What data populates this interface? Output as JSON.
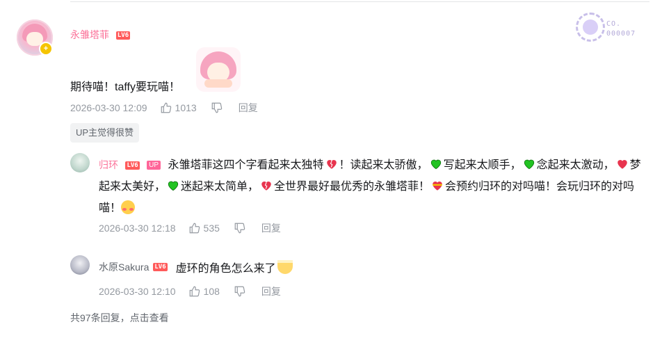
{
  "comment": {
    "username": "永雏塔菲",
    "level": "LV6",
    "text": "期待喵！taffy要玩喵！",
    "time": "2026-03-30 12:09",
    "likes": "1013",
    "reply_label": "回复",
    "up_liked": "UP主觉得很赞",
    "medal_text": [
      "CO.",
      "000007"
    ]
  },
  "replies": [
    {
      "username": "归环",
      "level": "LV6",
      "up_tag": "UP",
      "text_parts": [
        "永雏塔菲这四个字看起来太独特",
        "！读起来太骄傲，",
        "写起来太顺手，",
        "念起来太激动，",
        "梦起来太美好，",
        "迷起来太简单，",
        "全世界最好最优秀的永雏塔菲！",
        "会预约归环的对吗喵！会玩归环的对吗喵！"
      ],
      "time": "2026-03-30 12:18",
      "likes": "535",
      "reply_label": "回复"
    },
    {
      "username": "水原Sakura",
      "level": "LV6",
      "text": "虚环的角色怎么来了",
      "time": "2026-03-30 12:10",
      "likes": "108",
      "reply_label": "回复"
    }
  ],
  "view_all": "共97条回复，点击查看",
  "colors": {
    "username_pink": "#fb7299",
    "meta_gray": "#9499a0",
    "heart_green": "#22c322",
    "heart_red": "#e8344e"
  }
}
